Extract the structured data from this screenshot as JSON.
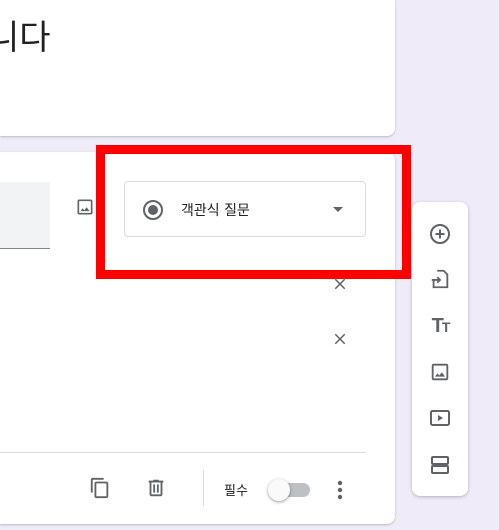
{
  "form": {
    "title_fragment": "니다"
  },
  "question": {
    "type_selector": {
      "selected_label": "객관식 질문",
      "icon": "radio-button-checked-icon"
    },
    "image_button_icon": "image-icon",
    "option_remove_icons": [
      "close-icon",
      "close-icon"
    ],
    "footer": {
      "duplicate_icon": "content-copy-icon",
      "delete_icon": "trash-icon",
      "required_label": "필수",
      "required_on": false,
      "more_icon": "more-vert-icon"
    }
  },
  "side_toolbar": {
    "tools": [
      {
        "name": "add-question",
        "icon": "add-circle-icon"
      },
      {
        "name": "import-questions",
        "icon": "import-icon"
      },
      {
        "name": "add-title",
        "icon": "text-fields-icon"
      },
      {
        "name": "add-image",
        "icon": "image-icon"
      },
      {
        "name": "add-video",
        "icon": "video-icon"
      },
      {
        "name": "add-section",
        "icon": "section-icon"
      }
    ]
  },
  "colors": {
    "background": "#f0ebf8",
    "highlight": "#ff0000",
    "icon": "#5f6368"
  }
}
